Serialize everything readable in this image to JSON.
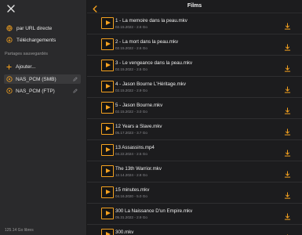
{
  "sidebar": {
    "nav": [
      {
        "label": "par URL directe",
        "icon": "globe-icon"
      },
      {
        "label": "Téléchargements",
        "icon": "download-circle-icon"
      }
    ],
    "section_title": "Partages sauvegardés",
    "add_label": "Ajouter...",
    "shares": [
      {
        "label": "NAS_PCM (SMB)",
        "selected": true
      },
      {
        "label": "NAS_PCM (FTP)",
        "selected": false
      }
    ],
    "storage": "125.14 Go libres"
  },
  "header": {
    "title": "Films"
  },
  "accent_color": "#f4a11f",
  "files": [
    {
      "name": "1 - La memoire dans la peau.mkv",
      "date": "02.15.2022",
      "size": "2.6 Go"
    },
    {
      "name": "2 - La mort dans la peau.mkv",
      "date": "02.15.2022",
      "size": "2.6 Go"
    },
    {
      "name": "3 - Le vengeance dans la peau.mkv",
      "date": "02.15.2022",
      "size": "2.5 Go"
    },
    {
      "name": "4 - Jason Bourne L'Héritage.mkv",
      "date": "02.15.2022",
      "size": "2.9 Go"
    },
    {
      "name": "5 - Jason Bourne.mkv",
      "date": "02.15.2022",
      "size": "3.0 Go"
    },
    {
      "name": "12 Years a Slave.mkv",
      "date": "05.17.2023",
      "size": "3.7 Go"
    },
    {
      "name": "13 Assassins.mp4",
      "date": "04.22.2024",
      "size": "2.5 Go"
    },
    {
      "name": "The 13th Warrior.mkv",
      "date": "12.14.2024",
      "size": "2.8 Go"
    },
    {
      "name": "15 minutes.mkv",
      "date": "04.16.2020",
      "size": "5.0 Go"
    },
    {
      "name": "300 La Naissance D'un Empire.mkv",
      "date": "05.31.2022",
      "size": "2.9 Go"
    },
    {
      "name": "300.mkv",
      "date": "05.31.2022",
      "size": "2.0 Go"
    }
  ]
}
